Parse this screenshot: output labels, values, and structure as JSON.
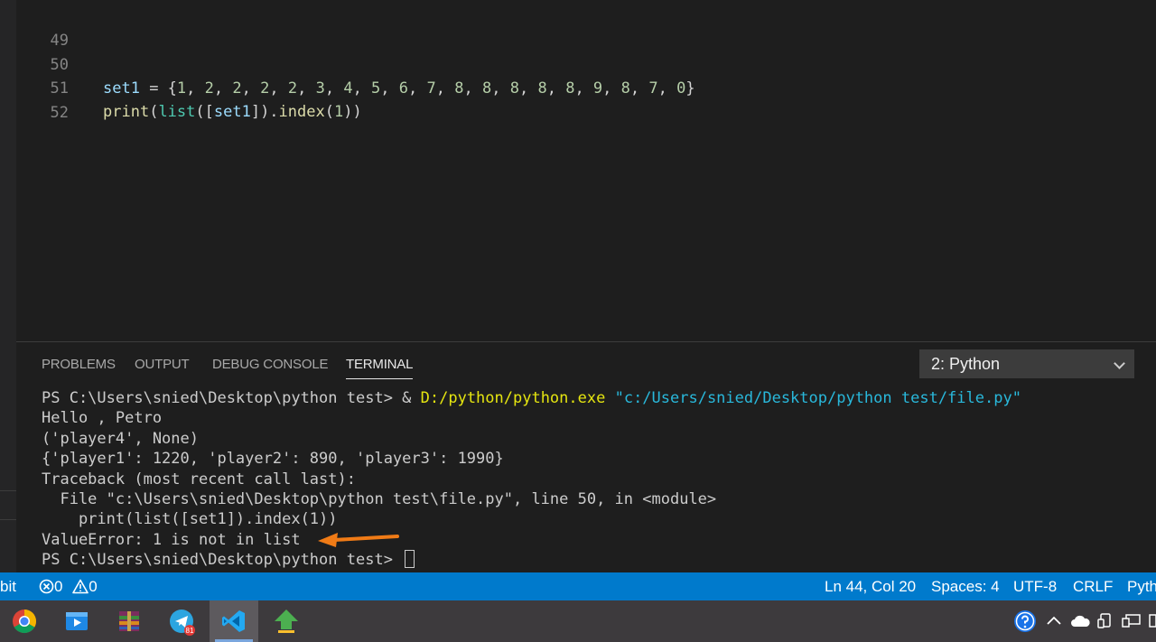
{
  "editor": {
    "lines": [
      {
        "no": "49",
        "code": ""
      },
      {
        "no": "50",
        "code": "set1 = {1, 2, 2, 2, 2, 3, 4, 5, 6, 7, 8, 8, 8, 8, 8, 9, 8, 7, 0}"
      },
      {
        "no": "51",
        "code": "print(list([set1]).index(1))"
      },
      {
        "no": "52",
        "code": ""
      }
    ]
  },
  "panel": {
    "tabs": [
      "PROBLEMS",
      "OUTPUT",
      "DEBUG CONSOLE",
      "TERMINAL"
    ],
    "active_tab": "TERMINAL",
    "terminal_selector": "2: Python",
    "terminal": {
      "prompt_cmd_prefix": "PS C:\\Users\\snied\\Desktop\\python test> & ",
      "exe": "D:/python/python.exe",
      "script": "\"c:/Users/snied/Desktop/python test/file.py\"",
      "output": [
        "Hello , Petro",
        "('player4', None)",
        "{'player1': 1220, 'player2': 890, 'player3': 1990}",
        "Traceback (most recent call last):",
        "  File \"c:\\Users\\snied\\Desktop\\python test\\file.py\", line 50, in <module>",
        "    print(list([set1]).index(1))",
        "ValueError: 1 is not in list"
      ],
      "final_prompt": "PS C:\\Users\\snied\\Desktop\\python test> "
    }
  },
  "statusbar": {
    "left_partial": "bit",
    "errors": "0",
    "warnings": "0",
    "position": "Ln 44, Col 20",
    "spaces": "Spaces: 4",
    "encoding": "UTF-8",
    "eol": "CRLF",
    "language_partial": "Pyth"
  },
  "taskbar": {
    "apps": [
      "chrome-icon",
      "video-player-icon",
      "winrar-icon",
      "telegram-icon",
      "vscode-icon",
      "upload-arrow-icon"
    ],
    "telegram_badge": "81"
  },
  "colors": {
    "accent": "#007acc",
    "annotation_arrow": "#f07b16"
  }
}
